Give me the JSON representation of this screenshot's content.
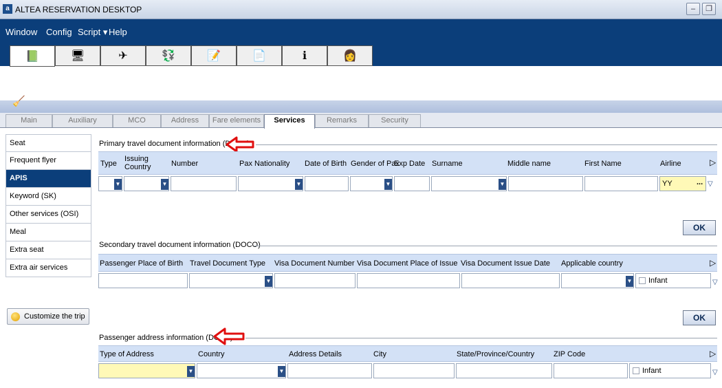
{
  "window": {
    "title": "ALTEA RESERVATION DESKTOP",
    "app_icon": "a"
  },
  "menu": [
    "Window",
    "Config",
    "Script ▾",
    "Help"
  ],
  "toolbar_icons": [
    "book-icon",
    "terminal-icon",
    "plane-icon",
    "money-icon",
    "notepad-icon",
    "document-icon",
    "info-icon",
    "agent-icon"
  ],
  "tabs": [
    "Main",
    "Auxiliary",
    "MCO",
    "Address",
    "Fare elements",
    "Services",
    "Remarks",
    "Security"
  ],
  "active_tab": "Services",
  "sidebar": {
    "items": [
      "Seat",
      "Frequent flyer",
      "APIS",
      "Keyword (SK)",
      "Other services (OSI)",
      "Meal",
      "Extra seat",
      "Extra air services"
    ],
    "active": "APIS",
    "customize_label": "Customize the trip"
  },
  "docs": {
    "title": "Primary travel document information (DOCS)",
    "headers": [
      "Type",
      "Issuing Country",
      "Number",
      "Pax Nationality",
      "Date of Birth",
      "Gender of Pax",
      "Exp Date",
      "Surname",
      "Middle name",
      "First Name",
      "Airline"
    ],
    "airline_value": "YY",
    "ellipsis": "...",
    "ok_label": "OK"
  },
  "doco": {
    "title": "Secondary travel document information (DOCO)",
    "headers": [
      "Passenger Place of Birth",
      "Travel Document Type",
      "Visa Document Number",
      "Visa Document Place of Issue",
      "Visa Document Issue Date",
      "Applicable country"
    ],
    "infant_label": "Infant",
    "ok_label": "OK"
  },
  "doca": {
    "title": "Passenger address information (DOCA)",
    "headers": [
      "Type of Address",
      "Country",
      "Address Details",
      "City",
      "State/Province/Country",
      "ZIP Code"
    ],
    "infant_label": "Infant"
  },
  "colors": {
    "accent": "#0b3e7a",
    "header_bg": "#d3e1f6",
    "highlight_field": "#fff9b7",
    "annotation_arrow": "#e01010"
  }
}
